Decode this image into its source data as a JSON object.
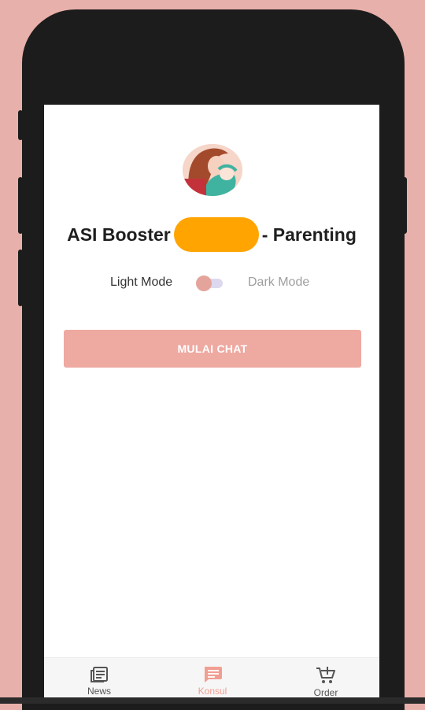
{
  "app": {
    "title_prefix": "ASI Booster",
    "title_suffix": "- Parenting"
  },
  "theme": {
    "light_label": "Light Mode",
    "dark_label": "Dark Mode",
    "dark_mode_enabled": false
  },
  "actions": {
    "start_chat_label": "MULAI CHAT"
  },
  "bottom_nav": {
    "items": [
      {
        "label": "News",
        "icon": "newspaper-icon",
        "active": false
      },
      {
        "label": "Konsul",
        "icon": "chat-icon",
        "active": true
      },
      {
        "label": "Order",
        "icon": "cart-icon",
        "active": false
      }
    ]
  },
  "colors": {
    "background": "#e8b0aa",
    "accent": "#eea9a1",
    "active_nav": "#f19e92",
    "redaction": "#ffa400"
  }
}
